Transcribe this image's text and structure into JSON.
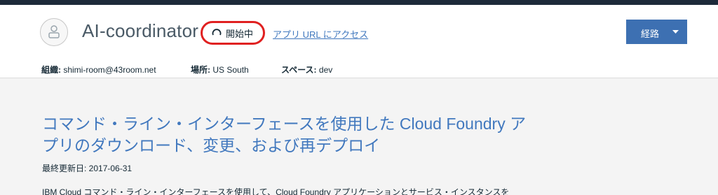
{
  "app": {
    "name": "AI-coordinator",
    "status": "開始中",
    "access_link": "アプリ URL にアクセス",
    "route_button": "経路"
  },
  "meta": {
    "org_label": "組織:",
    "org_value": "shimi-room@43room.net",
    "location_label": "場所:",
    "location_value": "US South",
    "space_label": "スペース:",
    "space_value": "dev"
  },
  "doc": {
    "title_line1": "コマンド・ライン・インターフェースを使用した Cloud Foundry ア",
    "title_line2": "プリのダウンロード、変更、および再デプロイ",
    "updated": "最終更新日: 2017-06-31",
    "body": "IBM Cloud コマンド・ライン・インターフェースを使用して、Cloud Foundry アプリケーションとサービス・インスタンスを"
  },
  "colors": {
    "accent": "#3d70b2",
    "link": "#4178be",
    "highlight": "#e02020",
    "topbar": "#1d2a3a"
  },
  "icons": {
    "app": "app-icon",
    "status": "spinner-icon",
    "route_caret": "caret-down-icon"
  }
}
